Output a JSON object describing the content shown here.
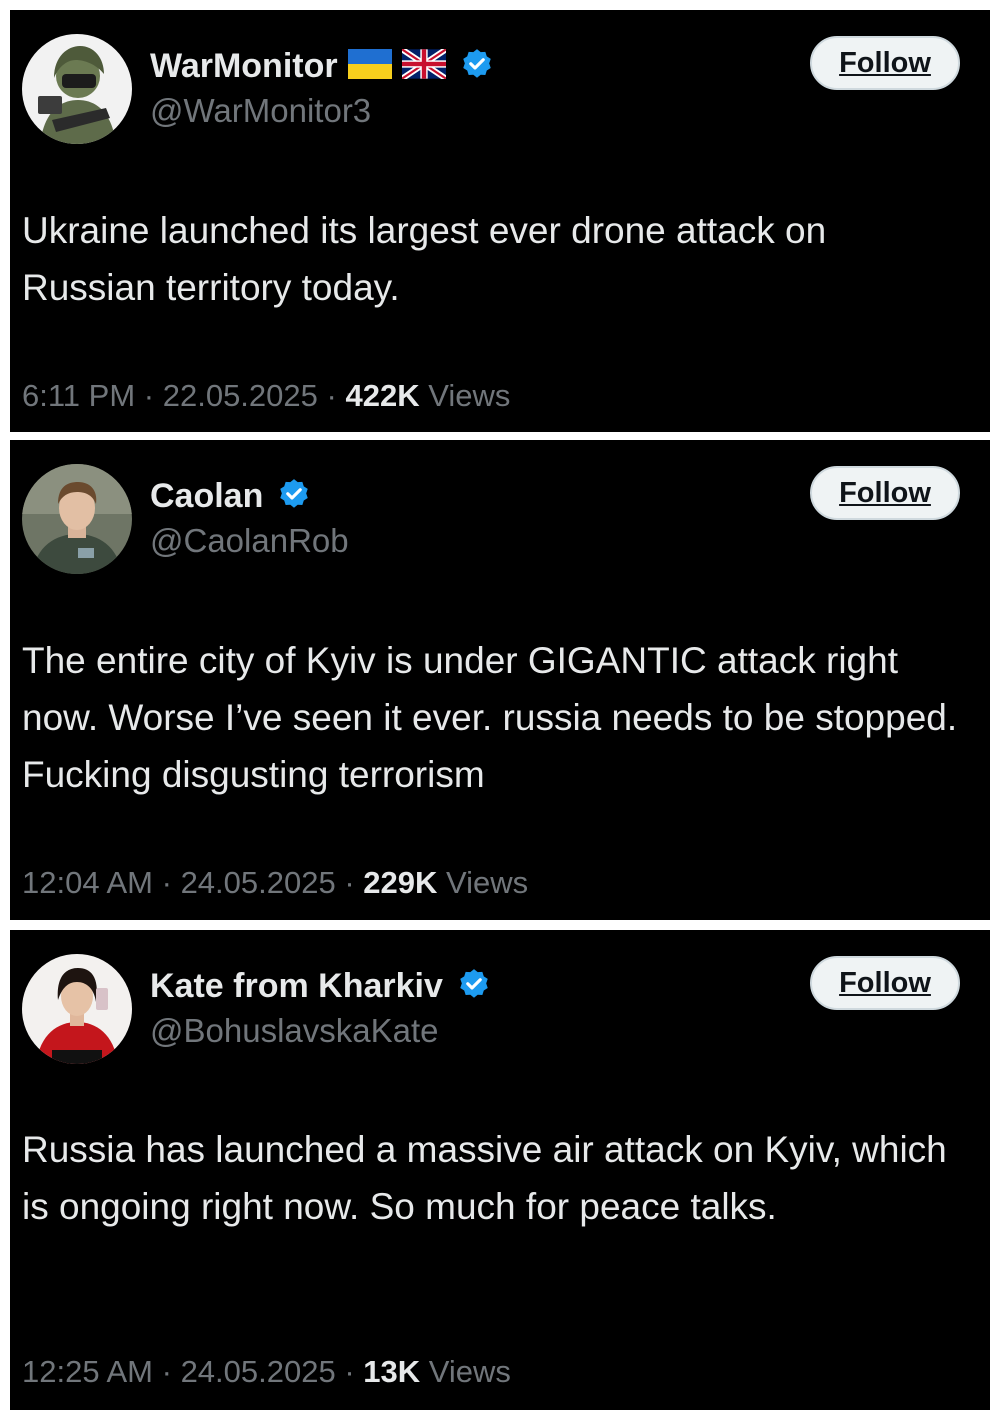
{
  "colors": {
    "background": "#000000",
    "text_primary": "#e7e9ea",
    "text_secondary": "#71767b",
    "verified_blue": "#1d9bf0",
    "follow_button_bg": "#eff3f4"
  },
  "tweets": [
    {
      "display_name": "WarMonitor",
      "name_icons": [
        "ukraine-flag-icon",
        "uk-flag-icon",
        "verified-badge-icon"
      ],
      "handle": "@WarMonitor3",
      "follow_label": "Follow",
      "text": "Ukraine launched its largest ever drone attack on Russian territory today.",
      "time": "6:11 PM",
      "date": "22.05.2025",
      "views_count": "422K",
      "views_label": "Views",
      "separator": "·"
    },
    {
      "display_name": "Caolan",
      "name_icons": [
        "verified-badge-icon"
      ],
      "handle": "@CaolanRob",
      "follow_label": "Follow",
      "text": "The entire city of Kyiv is under GIGANTIC attack right now. Worse I’ve seen it ever. russia needs to be stopped. Fucking disgusting terrorism",
      "time": "12:04 AM",
      "date": "24.05.2025",
      "views_count": "229K",
      "views_label": "Views",
      "separator": "·"
    },
    {
      "display_name": "Kate from Kharkiv",
      "name_icons": [
        "verified-badge-icon"
      ],
      "handle": "@BohuslavskaKate",
      "follow_label": "Follow",
      "text": "Russia has launched a massive air attack on Kyiv, which is ongoing right now. So much for peace talks.",
      "time": "12:25 AM",
      "date": "24.05.2025",
      "views_count": "13K",
      "views_label": "Views",
      "separator": "·"
    }
  ]
}
